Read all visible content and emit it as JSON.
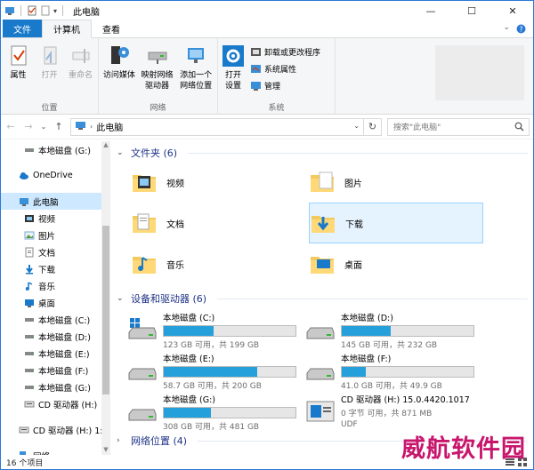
{
  "window": {
    "title": "此电脑",
    "minimize": "—",
    "maximize": "☐",
    "close": "✕"
  },
  "tabs": {
    "file": "文件",
    "computer": "计算机",
    "view": "查看"
  },
  "ribbon": {
    "location": {
      "label": "位置",
      "properties": "属性",
      "open": "打开",
      "rename": "重命名"
    },
    "network": {
      "label": "网络",
      "access_media": "访问媒体",
      "map_drive": "映射网络\n驱动器",
      "add_location": "添加一个\n网络位置"
    },
    "system": {
      "label": "系统",
      "open_settings": "打开\n设置",
      "uninstall": "卸载或更改程序",
      "sys_props": "系统属性",
      "manage": "管理"
    }
  },
  "address": {
    "path": "此电脑",
    "search_placeholder": "搜索\"此电脑\""
  },
  "nav": {
    "items": [
      {
        "label": "本地磁盘 (G:)",
        "icon": "drive"
      },
      {
        "label": "",
        "icon": "spacer"
      },
      {
        "label": "OneDrive",
        "icon": "cloud"
      },
      {
        "label": "",
        "icon": "spacer"
      },
      {
        "label": "此电脑",
        "icon": "pc",
        "selected": true
      },
      {
        "label": "视频",
        "icon": "video"
      },
      {
        "label": "图片",
        "icon": "picture"
      },
      {
        "label": "文档",
        "icon": "document"
      },
      {
        "label": "下载",
        "icon": "download"
      },
      {
        "label": "音乐",
        "icon": "music"
      },
      {
        "label": "桌面",
        "icon": "desktop"
      },
      {
        "label": "本地磁盘 (C:)",
        "icon": "drive"
      },
      {
        "label": "本地磁盘 (D:)",
        "icon": "drive"
      },
      {
        "label": "本地磁盘 (E:)",
        "icon": "drive"
      },
      {
        "label": "本地磁盘 (F:)",
        "icon": "drive"
      },
      {
        "label": "本地磁盘 (G:)",
        "icon": "drive"
      },
      {
        "label": "CD 驱动器 (H:)",
        "icon": "cd"
      },
      {
        "label": "",
        "icon": "spacer"
      },
      {
        "label": "CD 驱动器 (H:) 1:",
        "icon": "cd"
      },
      {
        "label": "",
        "icon": "spacer"
      },
      {
        "label": "网络",
        "icon": "network"
      }
    ]
  },
  "folders": {
    "header": "文件夹 (6)",
    "items": [
      {
        "label": "视频",
        "icon": "video"
      },
      {
        "label": "图片",
        "icon": "picture"
      },
      {
        "label": "文档",
        "icon": "document"
      },
      {
        "label": "下载",
        "icon": "download"
      },
      {
        "label": "音乐",
        "icon": "music"
      },
      {
        "label": "桌面",
        "icon": "desktop"
      }
    ]
  },
  "drives": {
    "header": "设备和驱动器 (6)",
    "items": [
      {
        "name": "本地磁盘 (C:)",
        "detail": "123 GB 可用，共 199 GB",
        "used_fraction": 0.38,
        "icon": "windows-drive"
      },
      {
        "name": "本地磁盘 (D:)",
        "detail": "145 GB 可用，共 232 GB",
        "used_fraction": 0.37,
        "icon": "drive"
      },
      {
        "name": "本地磁盘 (E:)",
        "detail": "58.7 GB 可用，共 200 GB",
        "used_fraction": 0.71,
        "icon": "drive"
      },
      {
        "name": "本地磁盘 (F:)",
        "detail": "41.0 GB 可用，共 49.9 GB",
        "used_fraction": 0.18,
        "icon": "drive"
      },
      {
        "name": "本地磁盘 (G:)",
        "detail": "308 GB 可用，共 481 GB",
        "used_fraction": 0.36,
        "icon": "drive"
      },
      {
        "name": "CD 驱动器 (H:) 15.0.4420.1017",
        "detail": "0 字节 可用，共 871 MB",
        "extra": "UDF",
        "used_fraction": null,
        "icon": "cd"
      }
    ]
  },
  "network_section": {
    "header": "网络位置 (4)"
  },
  "status": {
    "count": "16 个项目"
  },
  "watermark": "威航软件园",
  "colors": {
    "accent": "#1979ca",
    "bar_fill": "#26a0da",
    "selection": "#cde8ff",
    "section_header": "#1e3287"
  }
}
